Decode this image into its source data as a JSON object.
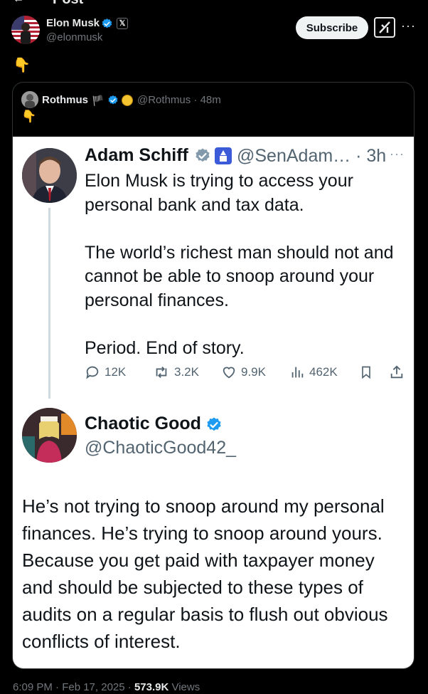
{
  "header": {
    "back_label": "←",
    "title": "Post"
  },
  "post": {
    "author_name": "Elon Musk",
    "author_handle": "@elonmusk",
    "xbadge": "𝕏",
    "subscribe_label": "Subscribe",
    "more_label": "···",
    "text": "👇"
  },
  "quote": {
    "author_name": "Rothmus",
    "flag": "🏴",
    "meta": "@Rothmus · 48m",
    "text": "👇",
    "screenshot": {
      "tweet1": {
        "name": "Adam Schiff",
        "handle_time": "@SenAdam… · 3h",
        "more": "···",
        "body": "Elon Musk is trying to access your personal bank and tax data.\n\nThe world’s richest man should not and cannot be able to snoop around your personal finances.\n\nPeriod. End of story.",
        "replies": "12K",
        "reposts": "3.2K",
        "likes": "9.9K",
        "views": "462K"
      },
      "tweet2": {
        "name": "Chaotic Good",
        "handle": "@ChaoticGood42_",
        "body": "He’s not trying to snoop around my personal finances.  He’s trying to snoop around yours. Because you get paid with taxpayer money and should be subjected to these types of audits on a regular basis to flush out obvious conflicts of interest."
      }
    }
  },
  "footer": {
    "timestamp": "6:09 PM · Feb 17, 2025 · ",
    "views_count": "573.9K",
    "views_label": " Views"
  },
  "colors": {
    "verified": "#1d9bf0",
    "background": "#000000",
    "muted": "#71767b",
    "accent_flag": "#3b5bd9"
  }
}
